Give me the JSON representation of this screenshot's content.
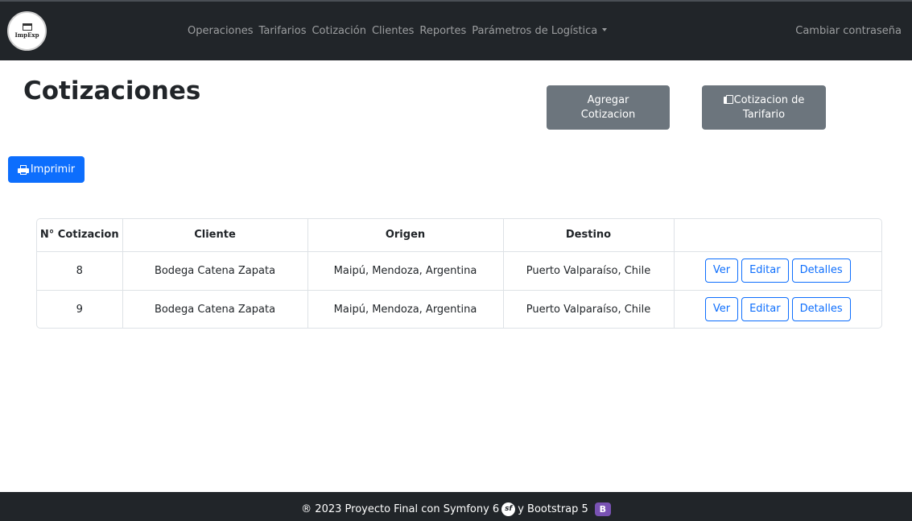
{
  "navbar": {
    "logo_text": "ImpExp",
    "links": [
      "Operaciones",
      "Tarifarios",
      "Cotización",
      "Clientes",
      "Reportes"
    ],
    "dropdown_label": "Parámetros de Logística",
    "right_link": "Cambiar contraseña"
  },
  "page": {
    "title": "Cotizaciones",
    "add_button": "Agregar Cotizacion",
    "tarifario_button": "Cotizacion de Tarifario",
    "print_button": "Imprimir"
  },
  "table": {
    "headers": [
      "N° Cotizacion",
      "Cliente",
      "Origen",
      "Destino",
      ""
    ],
    "rows": [
      {
        "num": "8",
        "cliente": "Bodega Catena Zapata",
        "origen": "Maipú, Mendoza, Argentina",
        "destino": "Puerto Valparaíso, Chile"
      },
      {
        "num": "9",
        "cliente": "Bodega Catena Zapata",
        "origen": "Maipú, Mendoza, Argentina",
        "destino": "Puerto Valparaíso, Chile"
      }
    ],
    "actions": {
      "ver": "Ver",
      "editar": "Editar",
      "detalles": "Detalles"
    }
  },
  "footer": {
    "text_before": "® 2023 Proyecto Final con Symfony 6",
    "symfony_icon": "sf",
    "text_after": "y Bootstrap 5",
    "bootstrap_icon": "B"
  },
  "colors": {
    "navbar_bg": "#212529",
    "primary": "#0d6efd",
    "secondary": "#6c757d"
  }
}
